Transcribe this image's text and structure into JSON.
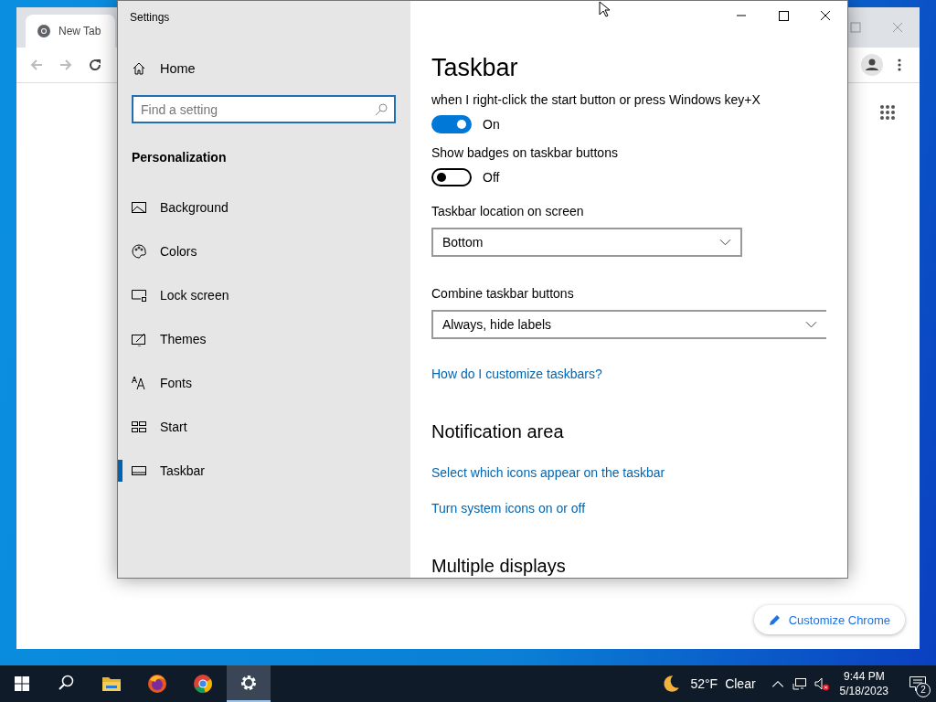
{
  "browser": {
    "tab": {
      "title": "New Tab"
    },
    "customize_button": "Customize Chrome"
  },
  "settings_window": {
    "title": "Settings",
    "sidebar": {
      "home": "Home",
      "search": {
        "placeholder": "Find a setting"
      },
      "section": "Personalization",
      "items": [
        {
          "label": "Background",
          "selected": false
        },
        {
          "label": "Colors",
          "selected": false
        },
        {
          "label": "Lock screen",
          "selected": false
        },
        {
          "label": "Themes",
          "selected": false
        },
        {
          "label": "Fonts",
          "selected": false
        },
        {
          "label": "Start",
          "selected": false
        },
        {
          "label": "Taskbar",
          "selected": true
        }
      ]
    },
    "page": {
      "heading": "Taskbar",
      "controls": [
        {
          "kind": "toggle",
          "label": "when I right-click the start button or press Windows key+X",
          "on": true,
          "state": "On"
        },
        {
          "kind": "toggle",
          "label": "Show badges on taskbar buttons",
          "on": false,
          "state": "Off"
        },
        {
          "kind": "dropdown",
          "label": "Taskbar location on screen",
          "value": "Bottom"
        },
        {
          "kind": "dropdown",
          "label": "Combine taskbar buttons",
          "value": "Always, hide labels"
        },
        {
          "kind": "link",
          "text": "How do I customize taskbars?"
        },
        {
          "kind": "heading",
          "text": "Notification area"
        },
        {
          "kind": "link",
          "text": "Select which icons appear on the taskbar"
        },
        {
          "kind": "link",
          "text": "Turn system icons on or off"
        },
        {
          "kind": "heading",
          "text": "Multiple displays"
        }
      ]
    }
  },
  "taskbar": {
    "apps": [
      {
        "selected": false
      },
      {
        "selected": false
      },
      {
        "selected": false
      },
      {
        "selected": true
      }
    ],
    "weather": {
      "temperature": "52°F",
      "condition": "Clear"
    },
    "clock": {
      "time": "9:44 PM",
      "date": "5/18/2023"
    },
    "notifications": {
      "count": "2"
    }
  }
}
